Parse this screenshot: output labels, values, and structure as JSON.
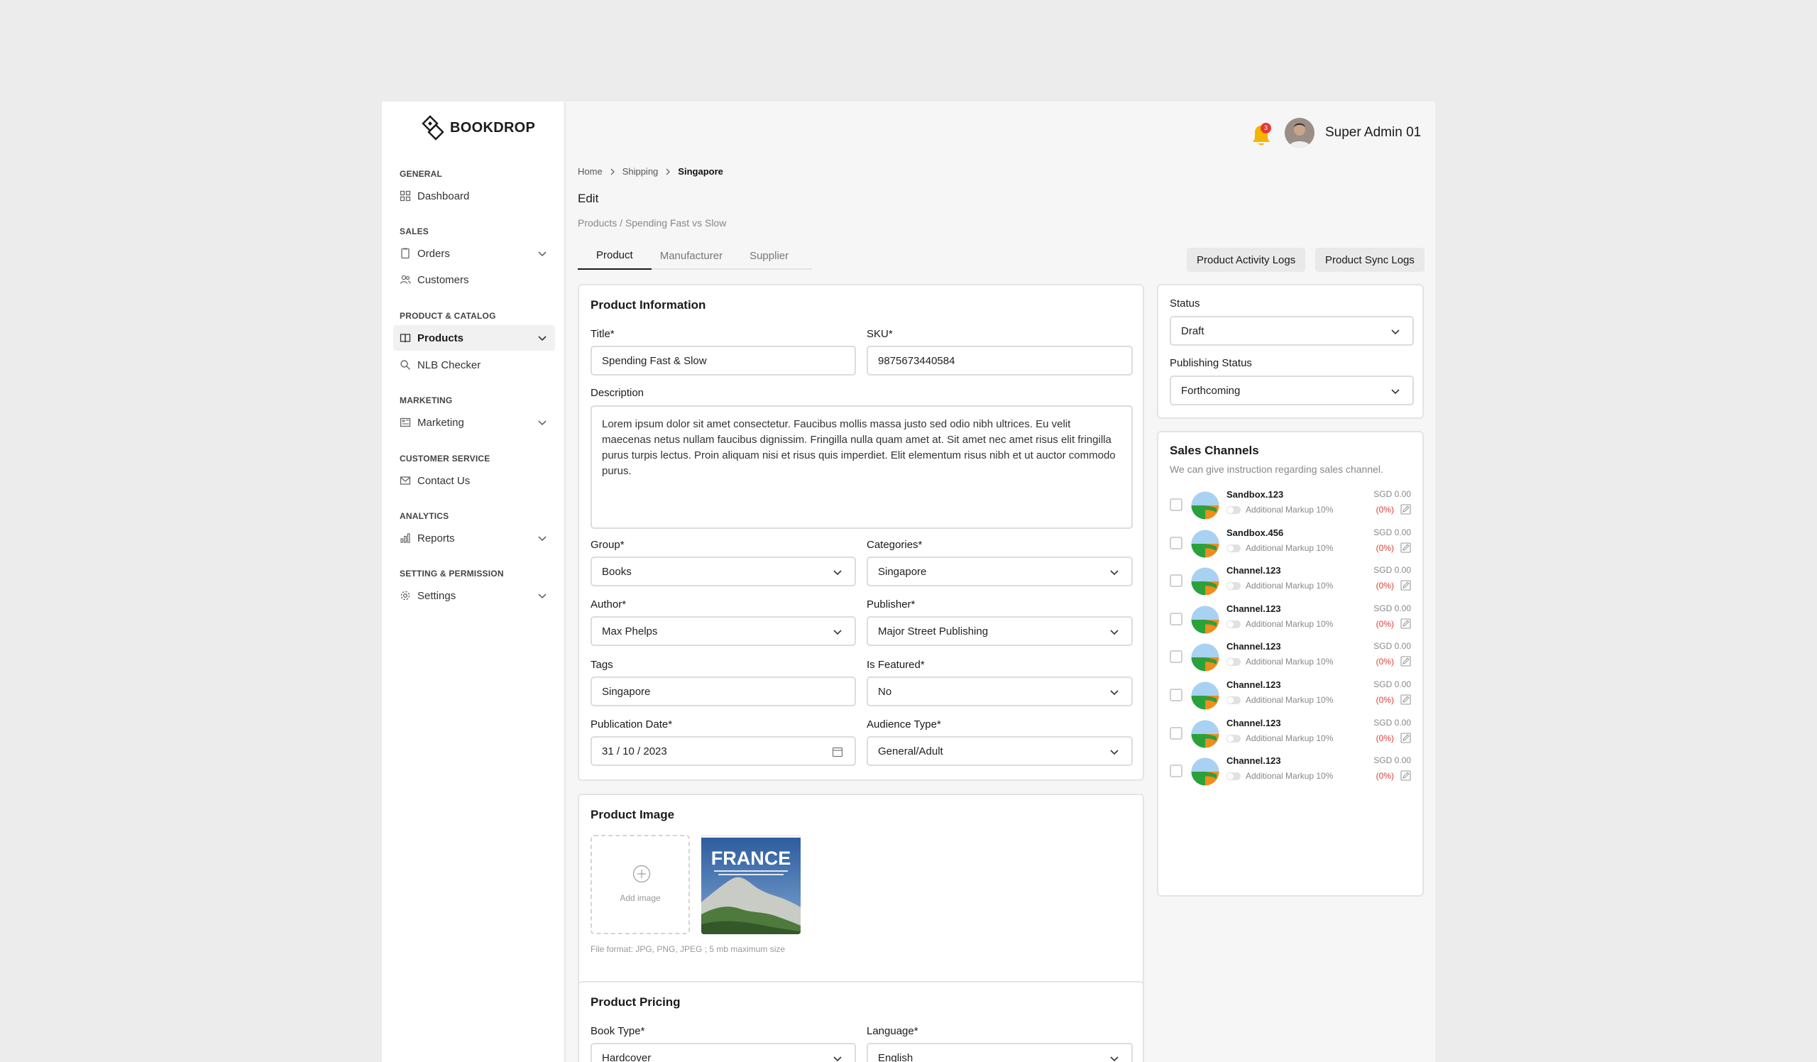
{
  "brand": {
    "name": "BOOKDROP"
  },
  "sidebar": {
    "sections": [
      {
        "title": "GENERAL",
        "items": [
          {
            "label": "Dashboard",
            "icon": "dashboard-icon"
          }
        ]
      },
      {
        "title": "SALES",
        "items": [
          {
            "label": "Orders",
            "icon": "orders-icon",
            "expandable": true
          },
          {
            "label": "Customers",
            "icon": "customers-icon"
          }
        ]
      },
      {
        "title": "PRODUCT & CATALOG",
        "items": [
          {
            "label": "Products",
            "icon": "book-icon",
            "expandable": true,
            "active": true
          },
          {
            "label": "NLB Checker",
            "icon": "search-icon"
          }
        ]
      },
      {
        "title": "MARKETING",
        "items": [
          {
            "label": "Marketing",
            "icon": "marketing-icon",
            "expandable": true
          }
        ]
      },
      {
        "title": "CUSTOMER SERVICE",
        "items": [
          {
            "label": "Contact Us",
            "icon": "mail-icon"
          }
        ]
      },
      {
        "title": "ANALYTICS",
        "items": [
          {
            "label": "Reports",
            "icon": "chart-icon",
            "expandable": true
          }
        ]
      },
      {
        "title": "SETTING & PERMISSION",
        "items": [
          {
            "label": "Settings",
            "icon": "gear-icon",
            "expandable": true
          }
        ]
      }
    ]
  },
  "header": {
    "notification_count": "3",
    "user_name": "Super Admin 01"
  },
  "breadcrumb": [
    "Home",
    "Shipping",
    "Singapore"
  ],
  "page": {
    "title": "Edit",
    "subpath": "Products / Spending Fast vs Slow"
  },
  "tabs": [
    "Product",
    "Manufacturer",
    "Supplier"
  ],
  "actions": {
    "activity_logs": "Product Activity Logs",
    "sync_logs": "Product Sync Logs"
  },
  "product_info": {
    "heading": "Product Information",
    "title_label": "Title*",
    "title_value": "Spending Fast & Slow",
    "sku_label": "SKU*",
    "sku_value": "9875673440584",
    "description_label": "Description",
    "description_value": "Lorem ipsum dolor sit amet consectetur. Faucibus mollis massa justo sed odio nibh ultrices. Eu velit maecenas netus nullam faucibus dignissim. Fringilla nulla quam amet at. Sit amet nec amet risus elit fringilla purus turpis lectus. Proin aliquam nisi et risus quis imperdiet. Elit elementum risus nibh et ut auctor commodo purus.",
    "group_label": "Group*",
    "group_value": "Books",
    "categories_label": "Categories*",
    "categories_value": "Singapore",
    "author_label": "Author*",
    "author_value": "Max Phelps",
    "publisher_label": "Publisher*",
    "publisher_value": "Major Street Publishing",
    "tags_label": "Tags",
    "tags_value": "Singapore",
    "featured_label": "Is Featured*",
    "featured_value": "No",
    "pubdate_label": "Publication Date*",
    "pubdate_value": "31 / 10 / 2023",
    "audience_label": "Audience Type*",
    "audience_value": "General/Adult"
  },
  "product_image": {
    "heading": "Product Image",
    "add_label": "Add image",
    "cover_title": "FRANCE",
    "hint": "File format: JPG, PNG, JPEG ; 5 mb maximum size"
  },
  "product_pricing": {
    "heading": "Product Pricing",
    "book_type_label": "Book Type*",
    "book_type_value": "Hardcover",
    "language_label": "Language*",
    "language_value": "English"
  },
  "status_card": {
    "status_label": "Status",
    "status_value": "Draft",
    "publishing_label": "Publishing Status",
    "publishing_value": "Forthcoming"
  },
  "sales_channels": {
    "heading": "Sales Channels",
    "subtitle": "We can give instruction regarding sales channel.",
    "rows": [
      {
        "name": "Sandbox.123",
        "price": "SGD 0.00",
        "markup": "Additional Markup 10%",
        "pct": "(0%)"
      },
      {
        "name": "Sandbox.456",
        "price": "SGD 0.00",
        "markup": "Additional Markup 10%",
        "pct": "(0%)"
      },
      {
        "name": "Channel.123",
        "price": "SGD 0.00",
        "markup": "Additional Markup 10%",
        "pct": "(0%)"
      },
      {
        "name": "Channel.123",
        "price": "SGD 0.00",
        "markup": "Additional Markup 10%",
        "pct": "(0%)"
      },
      {
        "name": "Channel.123",
        "price": "SGD 0.00",
        "markup": "Additional Markup 10%",
        "pct": "(0%)"
      },
      {
        "name": "Channel.123",
        "price": "SGD 0.00",
        "markup": "Additional Markup 10%",
        "pct": "(0%)"
      },
      {
        "name": "Channel.123",
        "price": "SGD 0.00",
        "markup": "Additional Markup 10%",
        "pct": "(0%)"
      },
      {
        "name": "Channel.123",
        "price": "SGD 0.00",
        "markup": "Additional Markup 10%",
        "pct": "(0%)"
      }
    ]
  },
  "colors": {
    "accent": "#1a1a1a",
    "bell": "#f5b400",
    "danger": "#e53935"
  }
}
